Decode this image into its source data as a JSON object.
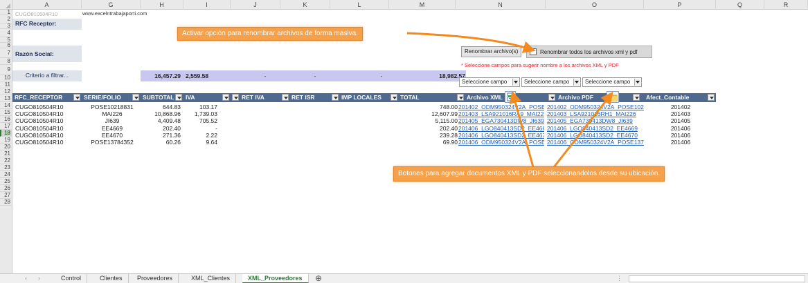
{
  "columns": [
    "A",
    "G",
    "H",
    "I",
    "J",
    "K",
    "L",
    "M",
    "N",
    "O",
    "P",
    "Q",
    "R"
  ],
  "rows": [
    "1",
    "2",
    "3",
    "4",
    "5",
    "6",
    "7",
    "8",
    "9",
    "10",
    "11",
    "12",
    "13",
    "14",
    "15",
    "16",
    "17",
    "18",
    "19",
    "20",
    "21",
    "22",
    "23",
    "24",
    "25",
    "26",
    "27",
    "28"
  ],
  "selected_row": "18",
  "top": {
    "a1": "CUGO810504R10",
    "g1": "www.excelntrabajaporti.com",
    "rfc_label": "RFC Receptor:",
    "razon_label": "Razón Social:",
    "criterio_label": "Criterio a filtrar...",
    "totals": {
      "subtotal": "16,457.29",
      "iva": "2,559.58",
      "ret_iva": "-",
      "ret_isr": "-",
      "imp_locales": "-",
      "total": "18,982.57"
    }
  },
  "controls": {
    "rename_button": "Renombrar archivo(s)",
    "rename_all_checkbox": "Renombrar todos los archivos xml y pdf",
    "hint": "* Seleccione campos para sugerir nombre  a los archivos XML y PDF",
    "combo_placeholder": "Seleccione campo"
  },
  "headers": {
    "rfc": "RFC_RECEPTOR",
    "serie": "SERIE/FOLIO",
    "subtotal": "SUBTOTAL",
    "iva": "IVA",
    "ret_iva": "RET IVA",
    "ret_isr": "RET ISR",
    "imp_locales": "IMP LOCALES",
    "total": "TOTAL",
    "xml": "Archivo XML",
    "pdf": "Archivo PDF",
    "afect": "Afect_Contable"
  },
  "data_rows": [
    {
      "rfc": "CUGO810504R10",
      "serie": "POSE10218831",
      "subtotal": "644.83",
      "iva": "103.17",
      "total": "748.00",
      "xml": "201402_ODM950324V2A_POSE10218831",
      "pdf": "201402_ODM950324V2A_POSE10218831",
      "afect": "201402"
    },
    {
      "rfc": "CUGO810504R10",
      "serie": "MAI226",
      "subtotal": "10,868.96",
      "iva": "1,739.03",
      "total": "12,607.99",
      "xml": "201403_LSA921016RA9_MAI226.xml",
      "pdf": "201403_LSA921016RH1_MAI226",
      "afect": "201403"
    },
    {
      "rfc": "CUGO810504R10",
      "serie": "JI639",
      "subtotal": "4,409.48",
      "iva": "705.52",
      "total": "5,115.00",
      "xml": "201405_EGA730413DW8_JI639.xml",
      "pdf": "201405_EGA730413DW8_JI639",
      "afect": "201405"
    },
    {
      "rfc": "CUGO810504R10",
      "serie": "EE4669",
      "subtotal": "202.40",
      "iva": "-",
      "total": "202.40",
      "xml": "201406_LGO840413SD2_EE4669.xml",
      "pdf": "201406_LGO840413SD2_EE4669",
      "afect": "201406"
    },
    {
      "rfc": "CUGO810504R10",
      "serie": "EE4670",
      "subtotal": "271.36",
      "iva": "2.22",
      "total": "239.28",
      "xml": "201406_LGO840413SD2_EE4670.xml",
      "pdf": "201406_LGO840413SD2_EE4670",
      "afect": "201406"
    },
    {
      "rfc": "CUGO810504R10",
      "serie": "POSE13784352",
      "subtotal": "60.26",
      "iva": "9.64",
      "total": "69.90",
      "xml": "201406_ODM950324V2A_POSE13784352",
      "pdf": "201406_ODM950324V2A_POSE13784352",
      "afect": "201406"
    }
  ],
  "callouts": {
    "top": "Activar opción para renombrar archivos de forma masiva.",
    "bottom": "Botones para agregar documentos XML y PDF seleccionandolos desde su ubicación."
  },
  "icons": {
    "xml": "xml-file-icon",
    "pdf": "folder-icon"
  },
  "colors": {
    "header_blue": "#4f6a8e",
    "totals_fill": "#c7c7f0",
    "callout_orange": "#f5a04a",
    "hint_red": "#d9262c",
    "active_tab_green": "#2e7d32"
  },
  "tabs": [
    "Control",
    "Clientes",
    "Proveedores",
    "XML_Clientes",
    "XML_Proveedores"
  ],
  "active_tab": "XML_Proveedores"
}
